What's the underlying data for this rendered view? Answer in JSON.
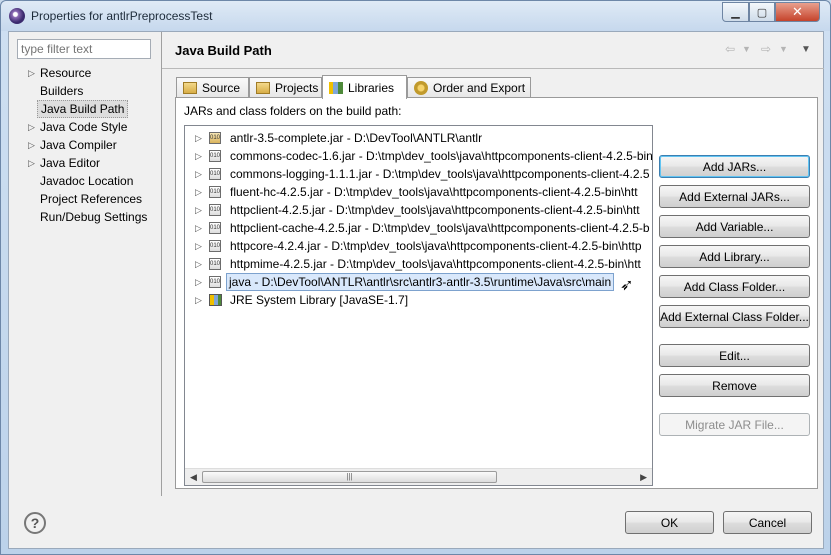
{
  "window": {
    "title": "Properties for antlrPreprocessTest"
  },
  "filter": {
    "placeholder": "type filter text"
  },
  "nav": [
    {
      "label": "Resource",
      "expandable": true
    },
    {
      "label": "Builders",
      "expandable": false
    },
    {
      "label": "Java Build Path",
      "expandable": false,
      "selected": true
    },
    {
      "label": "Java Code Style",
      "expandable": true
    },
    {
      "label": "Java Compiler",
      "expandable": true
    },
    {
      "label": "Java Editor",
      "expandable": true
    },
    {
      "label": "Javadoc Location",
      "expandable": false
    },
    {
      "label": "Project References",
      "expandable": false
    },
    {
      "label": "Run/Debug Settings",
      "expandable": false
    }
  ],
  "page": {
    "title": "Java Build Path"
  },
  "tabs": [
    {
      "label": "Source"
    },
    {
      "label": "Projects"
    },
    {
      "label": "Libraries",
      "active": true
    },
    {
      "label": "Order and Export"
    }
  ],
  "libraries": {
    "label": "JARs and class folders on the build path:",
    "entries": [
      {
        "text": "antlr-3.5-complete.jar - D:\\DevTool\\ANTLR\\antlr",
        "icon": "jar-special-icon"
      },
      {
        "text": "commons-codec-1.6.jar - D:\\tmp\\dev_tools\\java\\httpcomponents-client-4.2.5-bin\\",
        "icon": "jar-icon"
      },
      {
        "text": "commons-logging-1.1.1.jar - D:\\tmp\\dev_tools\\java\\httpcomponents-client-4.2.5",
        "icon": "jar-icon"
      },
      {
        "text": "fluent-hc-4.2.5.jar - D:\\tmp\\dev_tools\\java\\httpcomponents-client-4.2.5-bin\\htt",
        "icon": "jar-icon"
      },
      {
        "text": "httpclient-4.2.5.jar - D:\\tmp\\dev_tools\\java\\httpcomponents-client-4.2.5-bin\\htt",
        "icon": "jar-icon"
      },
      {
        "text": "httpclient-cache-4.2.5.jar - D:\\tmp\\dev_tools\\java\\httpcomponents-client-4.2.5-b",
        "icon": "jar-icon"
      },
      {
        "text": "httpcore-4.2.4.jar - D:\\tmp\\dev_tools\\java\\httpcomponents-client-4.2.5-bin\\http",
        "icon": "jar-icon"
      },
      {
        "text": "httpmime-4.2.5.jar - D:\\tmp\\dev_tools\\java\\httpcomponents-client-4.2.5-bin\\htt",
        "icon": "jar-icon"
      },
      {
        "text": "java - D:\\DevTool\\ANTLR\\antlr\\src\\antlr3-antlr-3.5\\runtime\\Java\\src\\main",
        "icon": "jar-icon",
        "selected": true
      },
      {
        "text": "JRE System Library [JavaSE-1.7]",
        "icon": "library-icon"
      }
    ]
  },
  "buttons": {
    "add_jars": "Add JARs...",
    "add_external_jars": "Add External JARs...",
    "add_variable": "Add Variable...",
    "add_library": "Add Library...",
    "add_class_folder": "Add Class Folder...",
    "add_external_class_folder": "Add External Class Folder...",
    "edit": "Edit...",
    "remove": "Remove",
    "migrate_jar": "Migrate JAR File..."
  },
  "footer": {
    "ok": "OK",
    "cancel": "Cancel"
  }
}
